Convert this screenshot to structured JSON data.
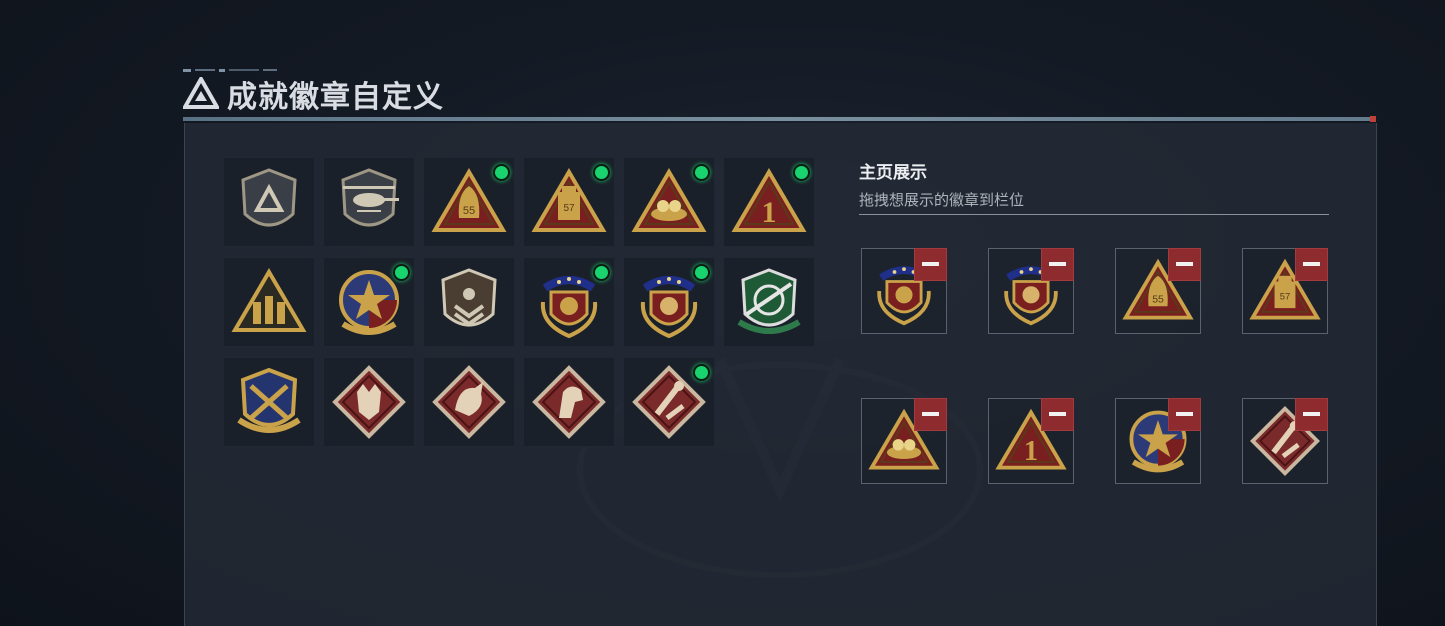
{
  "header": {
    "title": "成就徽章自定义"
  },
  "badges": [
    {
      "icon": "shield-tri-icon",
      "equipped": false
    },
    {
      "icon": "helicopter-badge-icon",
      "equipped": false
    },
    {
      "icon": "sack-55-badge-icon",
      "equipped": true
    },
    {
      "icon": "lantern-57-badge-icon",
      "equipped": true
    },
    {
      "icon": "nest-badge-icon",
      "equipped": true
    },
    {
      "icon": "rank-one-badge-icon",
      "equipped": true
    },
    {
      "icon": "soldiers-badge-icon",
      "equipped": false
    },
    {
      "icon": "star-medal-badge-icon",
      "equipped": true
    },
    {
      "icon": "chevron-shield-badge-icon",
      "equipped": false
    },
    {
      "icon": "wreath-blue-badge-icon",
      "equipped": true
    },
    {
      "icon": "wreath-red-badge-icon",
      "equipped": true
    },
    {
      "icon": "green-rifle-badge-icon",
      "equipped": false
    },
    {
      "icon": "crossed-rifles-badge-icon",
      "equipped": false
    },
    {
      "icon": "wolf-badge-icon",
      "equipped": false
    },
    {
      "icon": "dragon-badge-icon",
      "equipped": false
    },
    {
      "icon": "horse-badge-icon",
      "equipped": false
    },
    {
      "icon": "tools-badge-icon",
      "equipped": true
    }
  ],
  "showcase": {
    "title": "主页展示",
    "subtitle": "拖拽想展示的徽章到栏位",
    "slots": [
      {
        "icon": "wreath-blue-badge-icon"
      },
      {
        "icon": "wreath-red-badge-icon"
      },
      {
        "icon": "sack-55-badge-icon"
      },
      {
        "icon": "lantern-57-badge-icon"
      },
      {
        "icon": "nest-badge-icon"
      },
      {
        "icon": "rank-one-badge-icon"
      },
      {
        "icon": "star-medal-badge-icon"
      },
      {
        "icon": "tools-badge-icon"
      }
    ]
  },
  "colors": {
    "equipped_dot": "#19d36e",
    "remove_button": "#8d2b2f",
    "gold": "#c9a24a",
    "crimson": "#7a1f1f"
  },
  "badge_text": {
    "sack": "55",
    "lantern": "57",
    "rank": "1"
  }
}
